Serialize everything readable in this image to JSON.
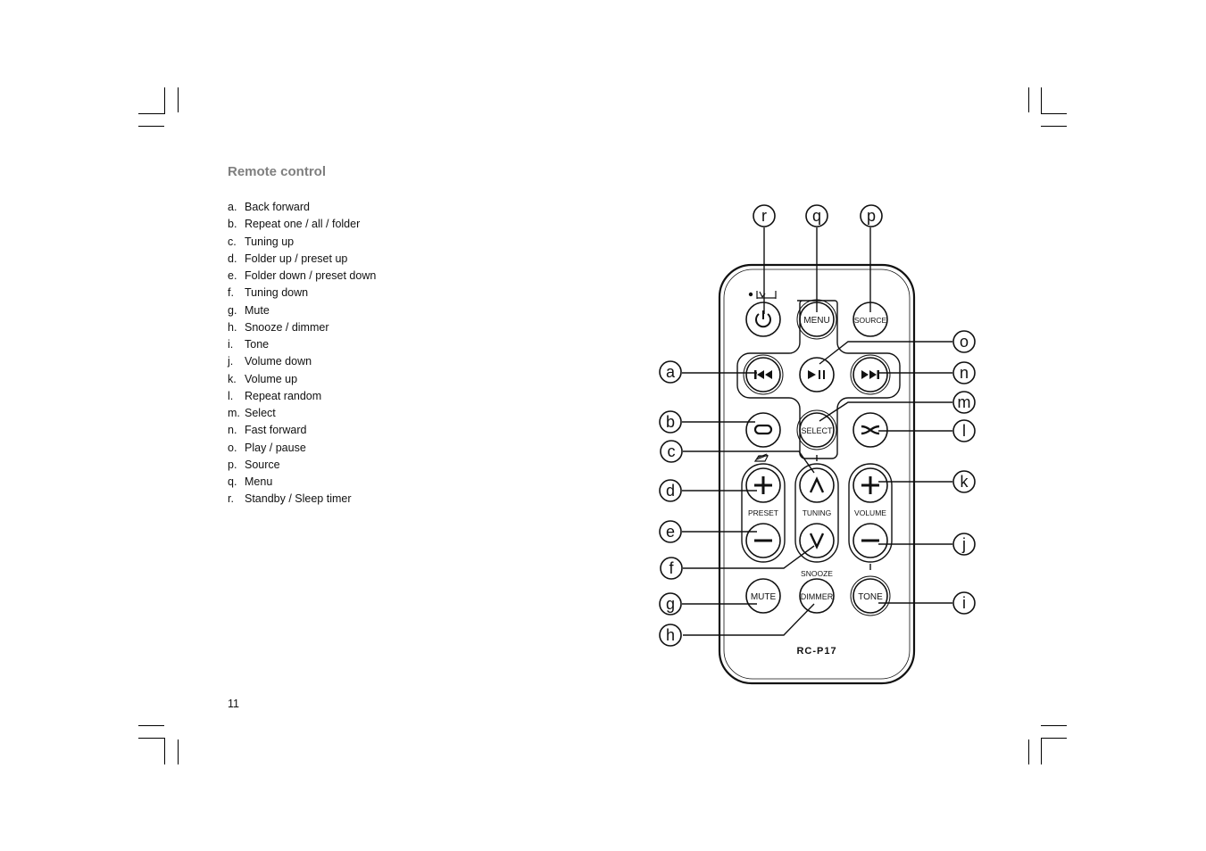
{
  "section_title": "Remote control",
  "items": [
    {
      "letter": "a.",
      "label": "Back forward"
    },
    {
      "letter": "b.",
      "label": "Repeat one / all / folder"
    },
    {
      "letter": "c.",
      "label": "Tuning up"
    },
    {
      "letter": "d.",
      "label": "Folder up / preset up"
    },
    {
      "letter": "e.",
      "label": "Folder down / preset down"
    },
    {
      "letter": "f.",
      "label": "Tuning down"
    },
    {
      "letter": "g.",
      "label": "Mute"
    },
    {
      "letter": "h.",
      "label": "Snooze / dimmer"
    },
    {
      "letter": "i.",
      "label": "Tone"
    },
    {
      "letter": "j.",
      "label": "Volume down"
    },
    {
      "letter": "k.",
      "label": "Volume up"
    },
    {
      "letter": "l.",
      "label": "Repeat random"
    },
    {
      "letter": "m.",
      "label": "Select"
    },
    {
      "letter": "n.",
      "label": "Fast forward"
    },
    {
      "letter": "o.",
      "label": "Play / pause"
    },
    {
      "letter": "p.",
      "label": "Source"
    },
    {
      "letter": "q.",
      "label": "Menu"
    },
    {
      "letter": "r.",
      "label": "Standby / Sleep timer"
    }
  ],
  "page_number": "11",
  "remote": {
    "model": "RC-P17",
    "buttons": {
      "menu": "MENU",
      "source": "SOURCE",
      "select": "SELECT",
      "mute": "MUTE",
      "dimmer": "DIMMER",
      "tone": "TONE"
    },
    "group_labels": {
      "preset": "PRESET",
      "tuning": "TUNING",
      "volume": "VOLUME",
      "snooze": "SNOOZE"
    },
    "callouts": {
      "a": "a",
      "b": "b",
      "c": "c",
      "d": "d",
      "e": "e",
      "f": "f",
      "g": "g",
      "h": "h",
      "i": "i",
      "j": "j",
      "k": "k",
      "l": "l",
      "m": "m",
      "n": "n",
      "o": "o",
      "p": "p",
      "q": "q",
      "r": "r"
    }
  }
}
